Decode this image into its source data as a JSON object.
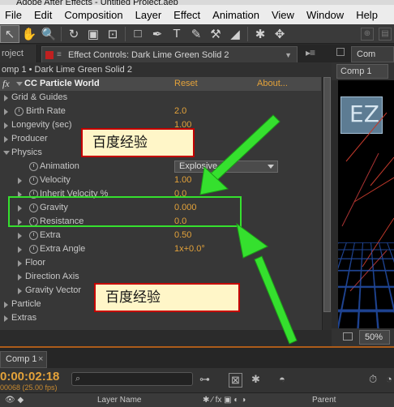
{
  "window": {
    "title": "Adobe After Effects - Untitled Project.aep"
  },
  "menu": [
    "File",
    "Edit",
    "Composition",
    "Layer",
    "Effect",
    "Animation",
    "View",
    "Window",
    "Help"
  ],
  "tools": [
    {
      "name": "selection-tool",
      "glyph": "↖"
    },
    {
      "name": "hand-tool",
      "glyph": "✋"
    },
    {
      "name": "zoom-tool",
      "glyph": "🔍"
    },
    {
      "name": "rotate-tool",
      "glyph": "↻"
    },
    {
      "name": "camera-tool",
      "glyph": "▣"
    },
    {
      "name": "pan-behind-tool",
      "glyph": "⊡"
    },
    {
      "name": "rectangle-tool",
      "glyph": "□"
    },
    {
      "name": "pen-tool",
      "glyph": "✒"
    },
    {
      "name": "type-tool",
      "glyph": "T"
    },
    {
      "name": "brush-tool",
      "glyph": "✎"
    },
    {
      "name": "clone-stamp-tool",
      "glyph": "⚒"
    },
    {
      "name": "eraser-tool",
      "glyph": "◢"
    },
    {
      "name": "roto-brush-tool",
      "glyph": "✱"
    },
    {
      "name": "puppet-pin-tool",
      "glyph": "✥"
    }
  ],
  "project_tab": {
    "label": "roject"
  },
  "effect_controls": {
    "tab_title": "Effect Controls: Dark Lime Green Solid 2",
    "subtitle": "omp 1 • Dark Lime Green Solid 2",
    "effect_name": "CC Particle World",
    "reset_label": "Reset",
    "about_label": "About...",
    "params": {
      "grid_guides": "Grid & Guides",
      "birth_rate": {
        "label": "Birth Rate",
        "value": "2.0"
      },
      "longevity": {
        "label": "Longevity (sec)",
        "value": "1.00"
      },
      "producer": "Producer",
      "physics": "Physics",
      "animation": {
        "label": "Animation",
        "value": "Explosive"
      },
      "velocity": {
        "label": "Velocity",
        "value": "1.00"
      },
      "inherit_velocity": {
        "label": "Inherit Velocity %",
        "value": "0.0"
      },
      "gravity": {
        "label": "Gravity",
        "value": "0.000"
      },
      "resistance": {
        "label": "Resistance",
        "value": "0.0"
      },
      "extra": {
        "label": "Extra",
        "value": "0.50"
      },
      "extra_angle": {
        "label": "Extra Angle",
        "value": "1x+0.0°"
      },
      "floor": "Floor",
      "direction_axis": "Direction Axis",
      "gravity_vector": "Gravity Vector",
      "particle": "Particle",
      "extras": "Extras"
    }
  },
  "annotations": {
    "callout_top": "百度经验",
    "callout_bottom": "百度经验",
    "arrow_color": "#35e02e",
    "highlight_color": "#35e02e"
  },
  "viewer": {
    "tab_label": "Com",
    "sub_tab": "Comp 1",
    "zoom": "50%",
    "overlay_text": "EZ"
  },
  "timeline": {
    "tab_label": "Comp 1",
    "timecode": "0:00:02:18",
    "frames": "00068 (25.00 fps)",
    "columns": {
      "layer_name": "Layer Name",
      "parent": "Parent"
    }
  },
  "colors": {
    "accent": "#e3a23a",
    "panel": "#373737",
    "highlight": "#35e02e",
    "callout_border": "#c40000"
  }
}
